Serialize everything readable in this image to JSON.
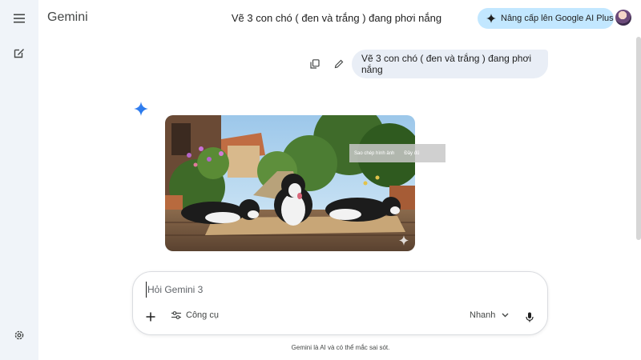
{
  "app": {
    "name": "Gemini"
  },
  "header": {
    "chat_title": "Vẽ 3 con chó ( đen và trắng ) đang phơi nắng",
    "upgrade_label": "Nâng cấp lên Google AI Plus"
  },
  "sidebar": {
    "items": [
      {
        "icon": "menu-icon"
      },
      {
        "icon": "new-chat-icon"
      },
      {
        "icon": "settings-icon"
      }
    ]
  },
  "conversation": {
    "user_message": "Vẽ 3 con chó ( đen và trắng ) đang phơi nắng",
    "response_image": {
      "subject": "three black and white border collies lying on a wooden deck in a sunny garden",
      "tooltip_text": "Sao chép hình ảnh",
      "tooltip_action": "Đầy đủ"
    }
  },
  "composer": {
    "placeholder": "Hỏi Gemini 3",
    "tools_label": "Công cụ",
    "mode_label": "Nhanh"
  },
  "footer": {
    "disclaimer": "Gemini là AI và có thể mắc sai sót."
  },
  "colors": {
    "sidebar_bg": "#f0f4f9",
    "upgrade_bg": "#c2e7ff",
    "bubble_bg": "#e9eef6",
    "spark_blue": "#4285f4"
  }
}
